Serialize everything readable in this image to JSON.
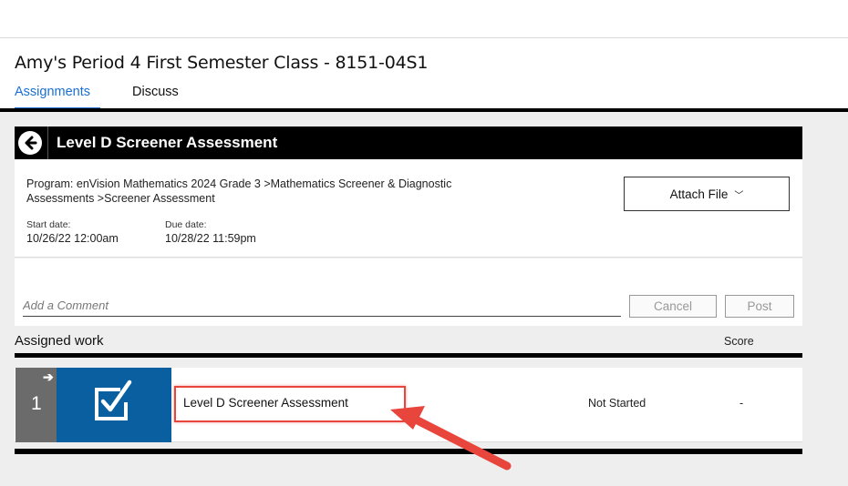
{
  "class_title": "Amy's Period 4 First Semester Class - 8151-04S1",
  "tabs": [
    {
      "label": "Assignments",
      "active": true
    },
    {
      "label": "Discuss",
      "active": false
    }
  ],
  "assignment": {
    "title": "Level D Screener Assessment",
    "program": "Program: enVision Mathematics 2024 Grade 3 >Mathematics Screener & Diagnostic Assessments >Screener Assessment",
    "start_label": "Start date:",
    "start_value": "10/26/22 12:00am",
    "due_label": "Due date:",
    "due_value": "10/28/22 11:59pm",
    "attach_label": "Attach File"
  },
  "comment": {
    "placeholder": "Add a Comment",
    "cancel_label": "Cancel",
    "post_label": "Post"
  },
  "assigned_work": {
    "heading": "Assigned work",
    "score_header": "Score",
    "rows": [
      {
        "number": "1",
        "title": "Level D Screener Assessment",
        "status": "Not Started",
        "score": "-"
      }
    ]
  },
  "colors": {
    "accent_blue": "#1a6fd1",
    "tile_blue": "#0a5fa0",
    "highlight_red": "#e8453c"
  }
}
